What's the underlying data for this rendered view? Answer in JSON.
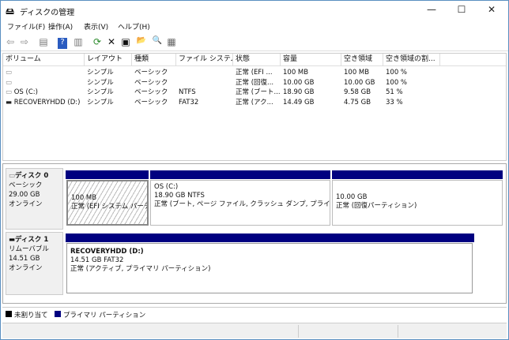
{
  "window": {
    "title": "ディスクの管理",
    "minimize": "—",
    "maximize": "☐",
    "close": "✕"
  },
  "menu": [
    "ファイル(F)",
    "操作(A)",
    "表示(V)",
    "ヘルプ(H)"
  ],
  "toolbar": [
    {
      "icon": "back-icon",
      "glyph": "⇦"
    },
    {
      "icon": "forward-icon",
      "glyph": "⇨"
    },
    {
      "icon": "show-hide-console-tree-icon",
      "glyph": "▤"
    },
    {
      "icon": "help-icon",
      "glyph": "?"
    },
    {
      "icon": "show-action-pane-icon",
      "glyph": "▥"
    },
    {
      "icon": "refresh-icon",
      "glyph": "⟳"
    },
    {
      "icon": "delete-icon",
      "glyph": "✕"
    },
    {
      "icon": "properties-icon",
      "glyph": "▣"
    },
    {
      "icon": "open-folder-icon",
      "glyph": "📂"
    },
    {
      "icon": "explore-icon",
      "glyph": "🔍"
    },
    {
      "icon": "settings-icon",
      "glyph": "▦"
    }
  ],
  "columns": [
    "ボリューム",
    "レイアウト",
    "種類",
    "ファイル システム",
    "状態",
    "容量",
    "空き領域",
    "空き領域の割..."
  ],
  "rows": [
    {
      "volume": "",
      "layout": "シンプル",
      "type": "ベーシック",
      "fs": "",
      "status": "正常 (EFI ...",
      "capacity": "100 MB",
      "free": "100 MB",
      "pct": "100 %"
    },
    {
      "volume": "",
      "layout": "シンプル",
      "type": "ベーシック",
      "fs": "",
      "status": "正常 (回復...",
      "capacity": "10.00 GB",
      "free": "10.00 GB",
      "pct": "100 %"
    },
    {
      "volume": "OS (C:)",
      "layout": "シンプル",
      "type": "ベーシック",
      "fs": "NTFS",
      "status": "正常 (ブート...",
      "capacity": "18.90 GB",
      "free": "9.58 GB",
      "pct": "51 %"
    },
    {
      "volume": "RECOVERYHDD (D:)",
      "layout": "シンプル",
      "type": "ベーシック",
      "fs": "FAT32",
      "status": "正常 (アク...",
      "capacity": "14.49 GB",
      "free": "4.75 GB",
      "pct": "33 %"
    }
  ],
  "disks": [
    {
      "name": "ディスク 0",
      "kind": "ベーシック",
      "size": "29.00 GB",
      "state": "オンライン",
      "partitions": [
        {
          "name": "",
          "size": "100 MB",
          "status": "正常 (EFI システム パーティ"
        },
        {
          "name": "OS  (C:)",
          "size": "18.90 GB NTFS",
          "status": "正常 (ブート, ページ ファイル, クラッシュ ダンプ, プライマリ パー"
        },
        {
          "name": "",
          "size": "10.00 GB",
          "status": "正常 (回復パーティション)"
        }
      ]
    },
    {
      "name": "ディスク 1",
      "kind": "リムーバブル",
      "size": "14.51 GB",
      "state": "オンライン",
      "partitions": [
        {
          "name": "RECOVERYHDD  (D:)",
          "size": "14.51 GB FAT32",
          "status": "正常 (アクティブ, プライマリ パーティション)"
        }
      ]
    }
  ],
  "legend": [
    {
      "label": "未割り当て",
      "color": "#000000"
    },
    {
      "label": "プライマリ パーティション",
      "color": "#000080"
    }
  ]
}
